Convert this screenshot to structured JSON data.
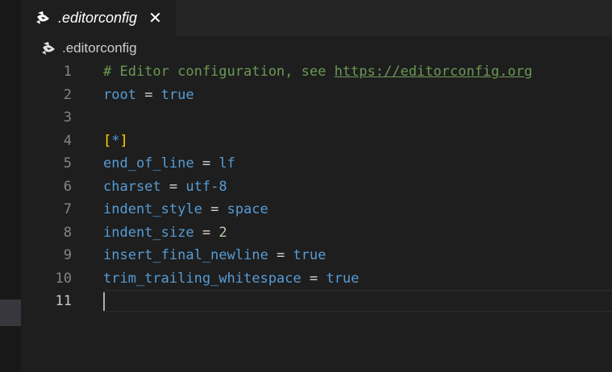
{
  "tab": {
    "title": ".editorconfig",
    "close_glyph": "✕",
    "icon": "editorconfig-file-icon"
  },
  "breadcrumb": {
    "label": ".editorconfig",
    "icon": "editorconfig-file-icon"
  },
  "editor": {
    "active_line": "11",
    "lines": [
      {
        "num": "1",
        "tokens": [
          {
            "t": "# Editor configuration, see ",
            "c": "comment"
          },
          {
            "t": "https://editorconfig.org",
            "c": "link"
          }
        ]
      },
      {
        "num": "2",
        "tokens": [
          {
            "t": "root",
            "c": "key"
          },
          {
            "t": " = ",
            "c": "op"
          },
          {
            "t": "true",
            "c": "val"
          }
        ]
      },
      {
        "num": "3",
        "tokens": []
      },
      {
        "num": "4",
        "tokens": [
          {
            "t": "[",
            "c": "brk"
          },
          {
            "t": "*",
            "c": "sect"
          },
          {
            "t": "]",
            "c": "brk"
          }
        ]
      },
      {
        "num": "5",
        "tokens": [
          {
            "t": "end_of_line",
            "c": "key"
          },
          {
            "t": " = ",
            "c": "op"
          },
          {
            "t": "lf",
            "c": "val"
          }
        ]
      },
      {
        "num": "6",
        "tokens": [
          {
            "t": "charset",
            "c": "key"
          },
          {
            "t": " = ",
            "c": "op"
          },
          {
            "t": "utf-8",
            "c": "val"
          }
        ]
      },
      {
        "num": "7",
        "tokens": [
          {
            "t": "indent_style",
            "c": "key"
          },
          {
            "t": " = ",
            "c": "op"
          },
          {
            "t": "space",
            "c": "val"
          }
        ]
      },
      {
        "num": "8",
        "tokens": [
          {
            "t": "indent_size",
            "c": "key"
          },
          {
            "t": " = ",
            "c": "op"
          },
          {
            "t": "2",
            "c": "num"
          }
        ]
      },
      {
        "num": "9",
        "tokens": [
          {
            "t": "insert_final_newline",
            "c": "key"
          },
          {
            "t": " = ",
            "c": "op"
          },
          {
            "t": "true",
            "c": "val"
          }
        ]
      },
      {
        "num": "10",
        "tokens": [
          {
            "t": "trim_trailing_whitespace",
            "c": "key"
          },
          {
            "t": " = ",
            "c": "op"
          },
          {
            "t": "true",
            "c": "val"
          }
        ]
      },
      {
        "num": "11",
        "tokens": []
      }
    ]
  },
  "colors": {
    "background": "#1e1e1e",
    "comment": "#6a9955",
    "keyword": "#569cd6",
    "number": "#b5cea8",
    "bracket": "#ffd700",
    "line_number": "#858585"
  }
}
